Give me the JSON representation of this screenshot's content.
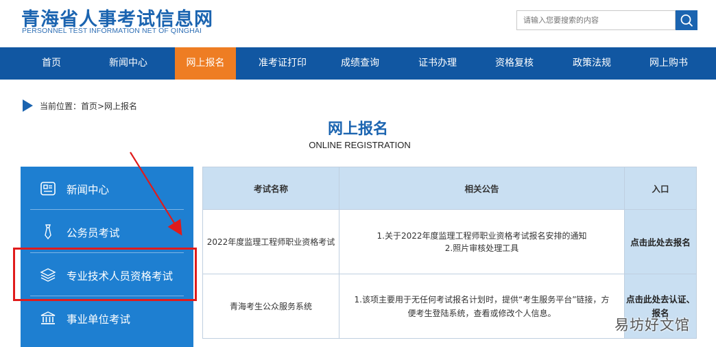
{
  "header": {
    "title": "青海省人事考试信息网",
    "subtitle": "PERSONNEL TEST INFORMATION NET OF QINGHAI",
    "search_placeholder": "请输入您要搜索的内容"
  },
  "nav": {
    "items": [
      {
        "label": "首页"
      },
      {
        "label": "新闻中心"
      },
      {
        "label": "网上报名",
        "active": true
      },
      {
        "label": "准考证打印"
      },
      {
        "label": "成绩查询"
      },
      {
        "label": "证书办理"
      },
      {
        "label": "资格复核"
      },
      {
        "label": "政策法规"
      },
      {
        "label": "网上购书"
      }
    ]
  },
  "breadcrumb": {
    "text": "当前位置：首页>网上报名"
  },
  "page": {
    "title": "网上报名",
    "subtitle": "ONLINE REGISTRATION"
  },
  "sidebar": {
    "items": [
      {
        "label": "新闻中心",
        "icon": "news-icon"
      },
      {
        "label": "公务员考试",
        "icon": "tie-icon"
      },
      {
        "label": "专业技术人员资格考试",
        "icon": "layers-icon"
      },
      {
        "label": "事业单位考试",
        "icon": "building-icon"
      }
    ]
  },
  "table": {
    "headers": [
      "考试名称",
      "相关公告",
      "入口"
    ],
    "rows": [
      {
        "name": "2022年度监理工程师职业资格考试",
        "notice_lines": [
          "1.关于2022年度监理工程师职业资格考试报名安排的通知",
          "2.照片审核处理工具"
        ],
        "entry": "点击此处去报名"
      },
      {
        "name": "青海考生公众服务系统",
        "notice_lines": [
          "1.该项主要用于无任何考试报名计划时，提供“考生服务平台”链接，方",
          "便考生登陆系统，查看或修改个人信息。"
        ],
        "entry": "点击此处去认证、报名"
      }
    ]
  },
  "watermark": "易坊好文馆",
  "colors": {
    "brand_blue": "#1157a2",
    "active_orange": "#ee7d23",
    "sidebar_blue": "#1e7fd1",
    "table_header": "#c9dff2",
    "annotation_red": "#e01b1b"
  }
}
